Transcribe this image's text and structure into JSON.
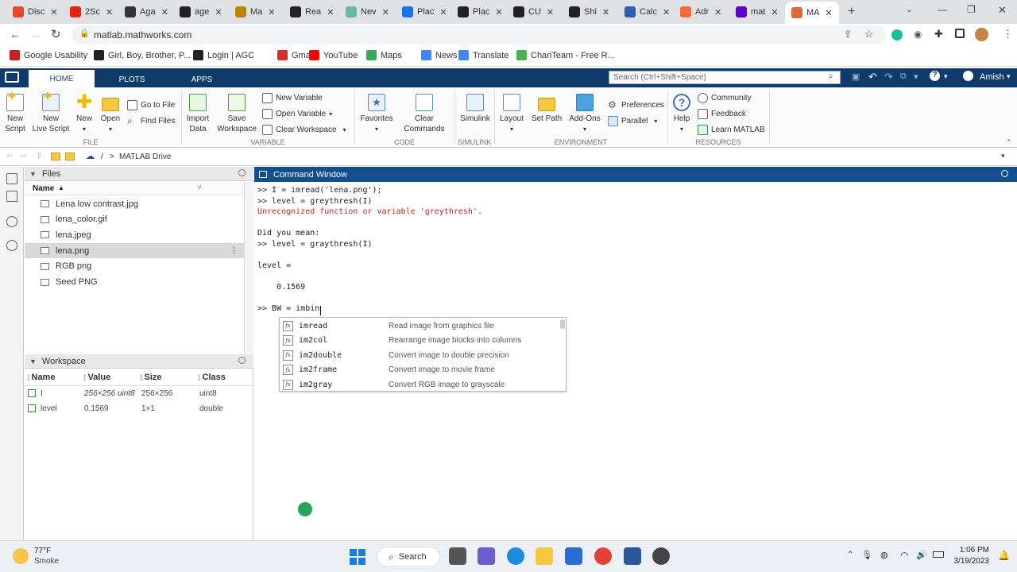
{
  "browser": {
    "tabs": [
      {
        "label": "Disc",
        "color": "#e8472b"
      },
      {
        "label": "2Sc",
        "color": "#e62117"
      },
      {
        "label": "Aga",
        "color": "#333333"
      },
      {
        "label": "age",
        "color": "#222222"
      },
      {
        "label": "Ma",
        "color": "#b58900"
      },
      {
        "label": "Rea",
        "color": "#222222"
      },
      {
        "label": "Nev",
        "color": "#6ab7a8"
      },
      {
        "label": "Plac",
        "color": "#1a73e8"
      },
      {
        "label": "Plac",
        "color": "#222222"
      },
      {
        "label": "CU",
        "color": "#222222"
      },
      {
        "label": "Shi",
        "color": "#222222"
      },
      {
        "label": "Calc",
        "color": "#2f5fb3"
      },
      {
        "label": "Adr",
        "color": "#f26c3a"
      },
      {
        "label": "mat",
        "color": "#6001d2"
      },
      {
        "label": "MA",
        "color": "#e16737"
      }
    ],
    "new_tab": "+",
    "url": "matlab.mathworks.com",
    "bookmarks": [
      {
        "label": "Google Usability",
        "color": "#c5221f"
      },
      {
        "label": "Girl, Boy, Brother, P...",
        "color": "#222222"
      },
      {
        "label": "Login | AGC",
        "color": "#222222"
      },
      {
        "label": "Gmail",
        "color": "#d93025"
      },
      {
        "label": "YouTube",
        "color": "#ff0000"
      },
      {
        "label": "Maps",
        "color": "#34a853"
      },
      {
        "label": "News",
        "color": "#4285f4"
      },
      {
        "label": "Translate",
        "color": "#4285f4"
      },
      {
        "label": "ChariTeam - Free R...",
        "color": "#4caf50"
      }
    ]
  },
  "matlab": {
    "tabs": [
      "HOME",
      "PLOTS",
      "APPS"
    ],
    "search_placeholder": "Search (Ctrl+Shift+Space)",
    "user": "Amish",
    "toolstrip": {
      "new_script": [
        "New",
        "Script"
      ],
      "new_live_script": [
        "New",
        "Live Script"
      ],
      "new": "New",
      "open": "Open",
      "go_to_file": "Go to File",
      "find_files": "Find Files",
      "import_data": [
        "Import",
        "Data"
      ],
      "save_workspace": [
        "Save",
        "Workspace"
      ],
      "new_variable": "New Variable",
      "open_variable": "Open Variable",
      "clear_workspace": "Clear Workspace",
      "favorites": "Favorites",
      "clear_commands": [
        "Clear",
        "Commands"
      ],
      "simulink": "Simulink",
      "layout": "Layout",
      "set_path": "Set Path",
      "add_ons": "Add-Ons",
      "preferences": "Preferences",
      "parallel": "Parallel",
      "help": "Help",
      "community": "Community",
      "feedback": "Feedback",
      "learn_matlab": "Learn MATLAB",
      "sections": [
        "FILE",
        "VARIABLE",
        "CODE",
        "SIMULINK",
        "ENVIRONMENT",
        "RESOURCES"
      ]
    },
    "path": [
      "/",
      ">",
      "MATLAB Drive"
    ],
    "files_panel": {
      "title": "Files",
      "column": "Name",
      "files": [
        "Lena low contrast.jpg",
        "lena_color.gif",
        "lena.jpeg",
        "lena.png",
        "RGB png",
        "Seed PNG"
      ],
      "selected": "lena.png"
    },
    "workspace_panel": {
      "title": "Workspace",
      "columns": [
        "Name",
        "Value",
        "Size",
        "Class"
      ],
      "rows": [
        {
          "name": "I",
          "value": "256×256 uint8",
          "size": "256×256",
          "class": "uint8"
        },
        {
          "name": "level",
          "value": "0.1569",
          "size": "1×1",
          "class": "double"
        }
      ]
    },
    "command_window": {
      "title": "Command Window",
      "lines": [
        {
          "text": ">> I = imread('lena.png');",
          "type": "cmd"
        },
        {
          "text": ">> level = greythresh(I)",
          "type": "cmd"
        },
        {
          "text": "Unrecognized function or variable 'greythresh'.",
          "type": "err"
        },
        {
          "text": "",
          "type": "blank"
        },
        {
          "text": "Did you mean:",
          "type": "cmd"
        },
        {
          "text": ">> level = graythresh(I)",
          "type": "cmd"
        },
        {
          "text": "",
          "type": "blank"
        },
        {
          "text": "level =",
          "type": "cmd"
        },
        {
          "text": "",
          "type": "blank"
        },
        {
          "text": "    0.1569",
          "type": "cmd"
        },
        {
          "text": "",
          "type": "blank"
        },
        {
          "text": ">> BW = imbin",
          "type": "cmd"
        }
      ],
      "autocomplete": [
        {
          "name": "imread",
          "desc": "Read image from graphics file"
        },
        {
          "name": "im2col",
          "desc": "Rearrange image blocks into columns"
        },
        {
          "name": "im2double",
          "desc": "Convert image to double precision"
        },
        {
          "name": "im2frame",
          "desc": "Convert image to movie frame"
        },
        {
          "name": "im2gray",
          "desc": "Convert RGB image to grayscale"
        }
      ],
      "fx": "fx"
    }
  },
  "taskbar": {
    "weather_temp": "77°F",
    "weather_desc": "Smoke",
    "search": "Search",
    "time": "1:06 PM",
    "date": "3/19/2023"
  }
}
